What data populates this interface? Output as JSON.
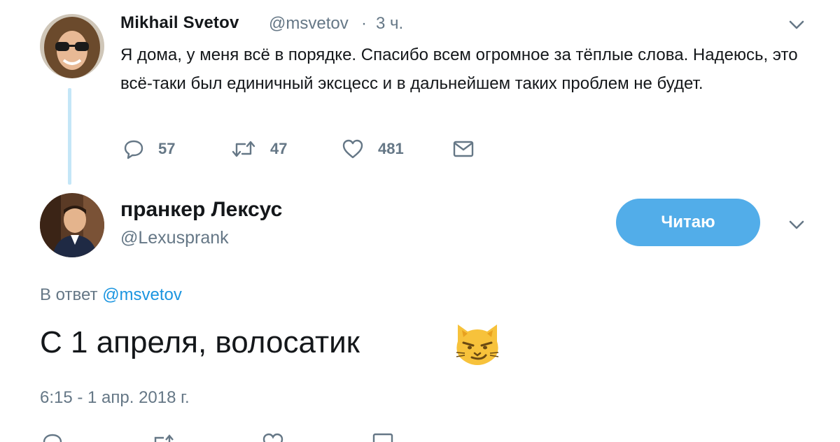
{
  "tweet1": {
    "author_name": "Mikhail Svetov",
    "handle": "@msvetov",
    "dot": "·",
    "time": "3 ч.",
    "text": "Я дома, у меня всё в порядке. Спасибо всем огромное за тёплые слова. Надеюсь, это всё-таки был единичный эксцесс и в дальнейшем таких проблем не будет.",
    "actions": {
      "replies": "57",
      "retweets": "47",
      "likes": "481"
    }
  },
  "tweet2": {
    "author_name": "пранкер Лексус",
    "handle": "@Lexusprank",
    "follow_label": "Читаю",
    "reply_prefix": "В ответ",
    "reply_to": "@msvetov",
    "text": "С 1 апреля, волосатик",
    "emoji": "smirking-cat-emoji",
    "timestamp": "6:15 - 1 апр. 2018 г."
  },
  "colors": {
    "accent": "#1b95e0",
    "follow_button": "#52ade9",
    "secondary_text": "#657786",
    "thread_line": "#c4e6f7"
  },
  "icons": {
    "reply": "reply-icon",
    "retweet": "retweet-icon",
    "like": "heart-icon",
    "dm": "envelope-icon",
    "more": "chevron-down-icon"
  }
}
